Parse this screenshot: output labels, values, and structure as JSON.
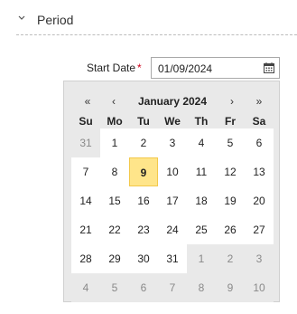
{
  "section": {
    "title": "Period"
  },
  "field": {
    "label": "Start Date",
    "required_mark": "*",
    "value": "01/09/2024"
  },
  "calendar": {
    "nav": {
      "prev_year": "«",
      "prev_month": "‹",
      "next_month": "›",
      "next_year": "»"
    },
    "month_title": "January 2024",
    "weekdays": [
      "Su",
      "Mo",
      "Tu",
      "We",
      "Th",
      "Fr",
      "Sa"
    ],
    "weeks": [
      [
        {
          "d": "31",
          "other": true
        },
        {
          "d": "1"
        },
        {
          "d": "2"
        },
        {
          "d": "3"
        },
        {
          "d": "4"
        },
        {
          "d": "5"
        },
        {
          "d": "6"
        }
      ],
      [
        {
          "d": "7"
        },
        {
          "d": "8"
        },
        {
          "d": "9",
          "selected": true
        },
        {
          "d": "10"
        },
        {
          "d": "11"
        },
        {
          "d": "12"
        },
        {
          "d": "13"
        }
      ],
      [
        {
          "d": "14"
        },
        {
          "d": "15"
        },
        {
          "d": "16"
        },
        {
          "d": "17"
        },
        {
          "d": "18"
        },
        {
          "d": "19"
        },
        {
          "d": "20"
        }
      ],
      [
        {
          "d": "21"
        },
        {
          "d": "22"
        },
        {
          "d": "23"
        },
        {
          "d": "24"
        },
        {
          "d": "25"
        },
        {
          "d": "26"
        },
        {
          "d": "27"
        }
      ],
      [
        {
          "d": "28"
        },
        {
          "d": "29"
        },
        {
          "d": "30"
        },
        {
          "d": "31"
        },
        {
          "d": "1",
          "other": true
        },
        {
          "d": "2",
          "other": true
        },
        {
          "d": "3",
          "other": true
        }
      ],
      [
        {
          "d": "4",
          "other": true
        },
        {
          "d": "5",
          "other": true
        },
        {
          "d": "6",
          "other": true
        },
        {
          "d": "7",
          "other": true
        },
        {
          "d": "8",
          "other": true
        },
        {
          "d": "9",
          "other": true
        },
        {
          "d": "10",
          "other": true
        }
      ]
    ]
  },
  "icons": {
    "collapse": "chevron-down-icon",
    "calendar": "calendar-icon"
  },
  "colors": {
    "selected_bg": "#ffe58a",
    "selected_border": "#f3c84a",
    "required": "#d0021b",
    "other_month_text": "#8a8a8a"
  }
}
